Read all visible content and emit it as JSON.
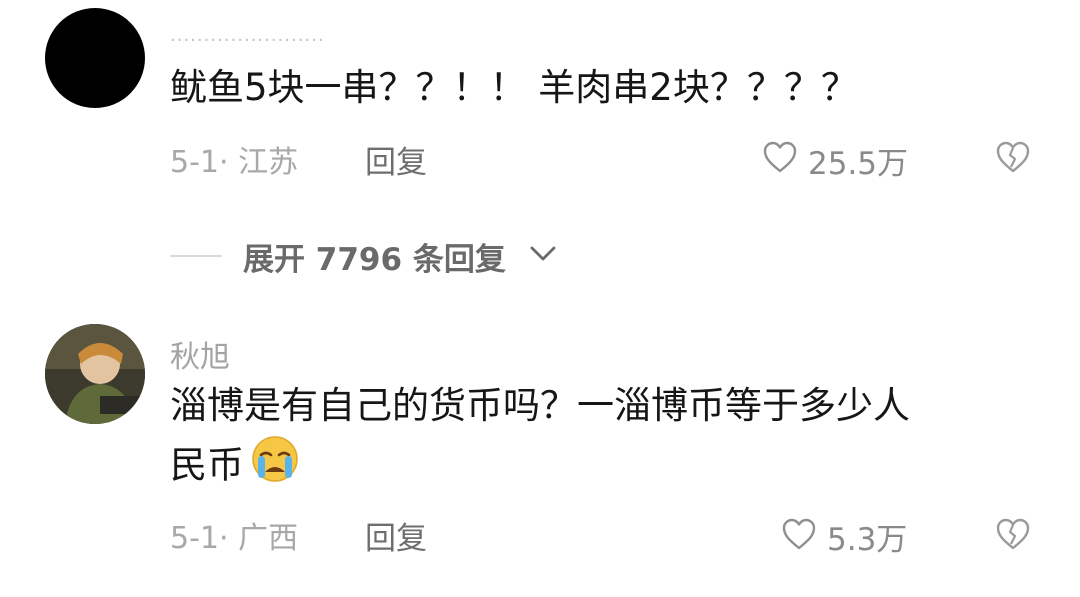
{
  "comments": [
    {
      "username": "·······················",
      "text": "鱿鱼5块一串？？！！ 羊肉串2块？？？？",
      "date_location": "5-1· 江苏",
      "reply_label": "回复",
      "likes": "25.5万",
      "expand_replies": "展开 7796 条回复"
    },
    {
      "username": "秋旭",
      "text_line1": "淄博是有自己的货币吗？一淄博币等于多少人",
      "text_line2": "民币",
      "emoji": "loudly-crying-face",
      "date_location": "5-1· 广西",
      "reply_label": "回复",
      "likes": "5.3万"
    }
  ],
  "colors": {
    "text_primary": "#161616",
    "text_muted": "#a8a8a8",
    "icon_gray": "#999999"
  }
}
